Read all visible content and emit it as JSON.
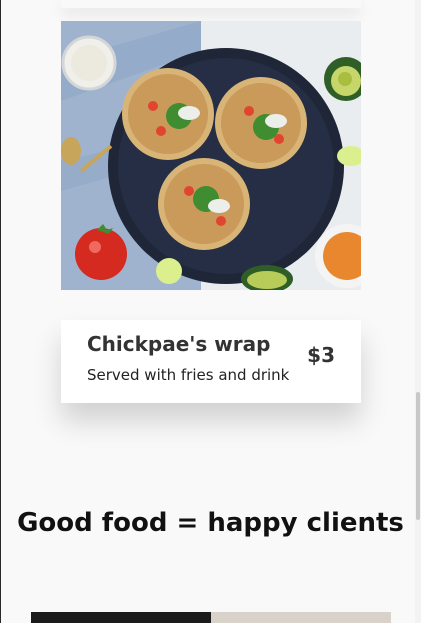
{
  "menu_item": {
    "name": "Chickpae's wrap",
    "description": "Served with fries and drink",
    "price": "$3"
  },
  "section": {
    "heading": "Good food = happy clients"
  },
  "colors": {
    "background": "#f9f9f9",
    "card": "#ffffff",
    "text_dark": "#333333"
  }
}
